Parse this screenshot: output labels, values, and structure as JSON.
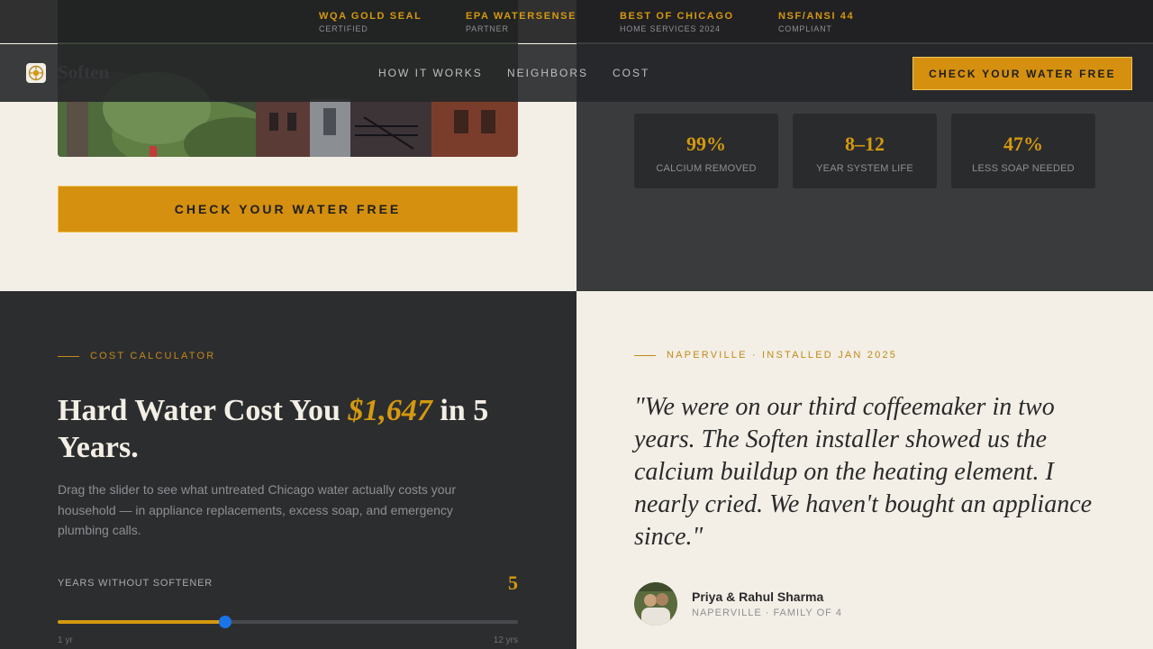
{
  "trust_badges": [
    {
      "title": "WQA GOLD SEAL",
      "subtitle": "CERTIFIED"
    },
    {
      "title": "EPA WATERSENSE",
      "subtitle": "PARTNER"
    },
    {
      "title": "BEST OF CHICAGO",
      "subtitle": "HOME SERVICES 2024"
    },
    {
      "title": "NSF/ANSI 44",
      "subtitle": "COMPLIANT"
    }
  ],
  "nav": {
    "logo_text": "Soften",
    "links": [
      "HOW IT WORKS",
      "NEIGHBORS",
      "COST"
    ],
    "cta_label": "CHECK YOUR WATER FREE"
  },
  "hero": {
    "cta_label": "CHECK YOUR WATER FREE"
  },
  "stats": [
    {
      "value": "99%",
      "label": "CALCIUM REMOVED"
    },
    {
      "value": "8–12",
      "label": "YEAR SYSTEM LIFE"
    },
    {
      "value": "47%",
      "label": "LESS SOAP NEEDED"
    }
  ],
  "calculator": {
    "eyebrow": "COST CALCULATOR",
    "title_prefix": "Hard Water Cost You",
    "title_amount": "$1,647",
    "title_suffix": "in 5 Years.",
    "description": "Drag the slider to see what untreated Chicago water actually costs your household — in appliance replacements, excess soap, and emergency plumbing calls.",
    "slider_label": "YEARS WITHOUT SOFTENER",
    "slider_value": "5",
    "slider_min_label": "1 yr",
    "slider_max_label": "12 yrs",
    "slider_min": 1,
    "slider_max": 12,
    "slider_current": 5
  },
  "testimonial": {
    "eyebrow": "NAPERVILLE · INSTALLED JAN 2025",
    "quote": "\"We were on our third coffeemaker in two years. The Soften installer showed us the calcium buildup on the heating element. I nearly cried. We haven't bought an appliance since.\"",
    "author_name": "Priya & Rahul Sharma",
    "author_meta": "NAPERVILLE · FAMILY OF 4"
  },
  "colors": {
    "accent": "#d4990f",
    "dark": "#2c2d2f",
    "cream": "#f3efe6"
  }
}
